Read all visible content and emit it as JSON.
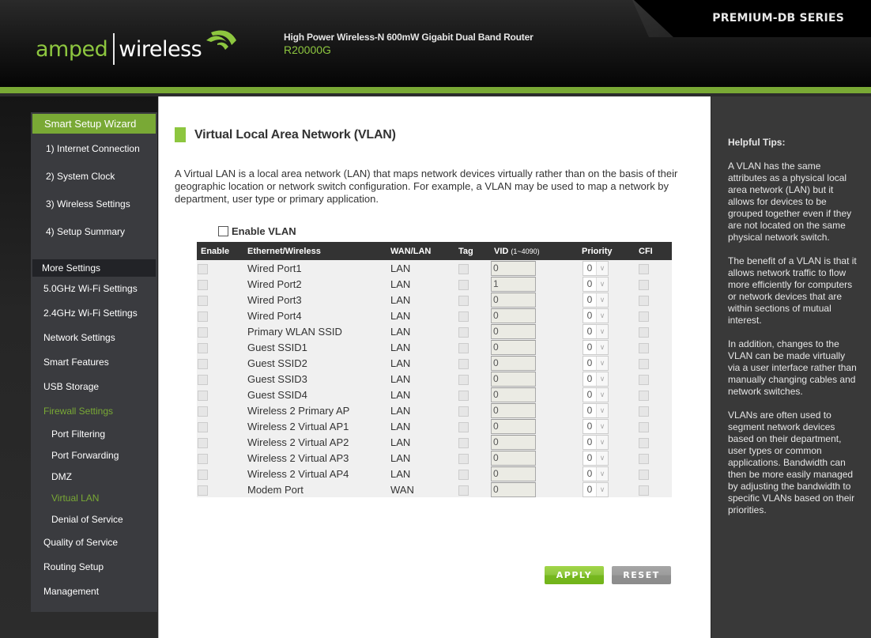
{
  "header": {
    "brand_left": "amped",
    "brand_right": "wireless",
    "product_desc": "High Power Wireless-N 600mW Gigabit Dual Band Router",
    "model": "R20000G",
    "series": "PREMIUM-DB SERIES"
  },
  "sidebar": {
    "wizard_title": "Smart Setup Wizard",
    "wizard_items": [
      {
        "label": "1) Internet Connection"
      },
      {
        "label": "2) System Clock"
      },
      {
        "label": "3) Wireless Settings"
      },
      {
        "label": "4) Setup Summary"
      }
    ],
    "more_title": "More Settings",
    "nav_items_top": [
      {
        "label": "5.0GHz Wi-Fi Settings"
      },
      {
        "label": "2.4GHz Wi-Fi Settings"
      },
      {
        "label": "Network Settings"
      },
      {
        "label": "Smart Features"
      },
      {
        "label": "USB Storage"
      },
      {
        "label": "Firewall Settings",
        "active": true
      }
    ],
    "firewall_sub": [
      {
        "label": "Port Filtering"
      },
      {
        "label": "Port Forwarding"
      },
      {
        "label": "DMZ"
      },
      {
        "label": "Virtual LAN",
        "active": true
      },
      {
        "label": "Denial of Service"
      }
    ],
    "nav_items_bottom": [
      {
        "label": "Quality of Service"
      },
      {
        "label": "Routing Setup"
      },
      {
        "label": "Management"
      }
    ]
  },
  "main": {
    "title": "Virtual Local Area Network (VLAN)",
    "intro": "A Virtual LAN is a local area network (LAN) that maps network devices virtually rather than on the basis of their geographic location or network switch configuration. For example, a VLAN may be used to map a network by department, user type or primary application.",
    "enable_vlan_label": "Enable VLAN",
    "enable_vlan_checked": false,
    "table": {
      "headers": {
        "enable": "Enable",
        "iface": "Ethernet/Wireless",
        "wanlan": "WAN/LAN",
        "tag": "Tag",
        "vid": "VID",
        "vid_range": "(1~4090)",
        "priority": "Priority",
        "cfi": "CFI"
      },
      "rows": [
        {
          "iface": "Wired Port1",
          "wanlan": "LAN",
          "vid": "0",
          "priority": "0"
        },
        {
          "iface": "Wired Port2",
          "wanlan": "LAN",
          "vid": "1",
          "priority": "0"
        },
        {
          "iface": "Wired Port3",
          "wanlan": "LAN",
          "vid": "0",
          "priority": "0"
        },
        {
          "iface": "Wired Port4",
          "wanlan": "LAN",
          "vid": "0",
          "priority": "0"
        },
        {
          "iface": "Primary WLAN SSID",
          "wanlan": "LAN",
          "vid": "0",
          "priority": "0"
        },
        {
          "iface": "Guest SSID1",
          "wanlan": "LAN",
          "vid": "0",
          "priority": "0"
        },
        {
          "iface": "Guest SSID2",
          "wanlan": "LAN",
          "vid": "0",
          "priority": "0"
        },
        {
          "iface": "Guest SSID3",
          "wanlan": "LAN",
          "vid": "0",
          "priority": "0"
        },
        {
          "iface": "Guest SSID4",
          "wanlan": "LAN",
          "vid": "0",
          "priority": "0"
        },
        {
          "iface": "Wireless 2 Primary AP",
          "wanlan": "LAN",
          "vid": "0",
          "priority": "0"
        },
        {
          "iface": "Wireless 2 Virtual AP1",
          "wanlan": "LAN",
          "vid": "0",
          "priority": "0"
        },
        {
          "iface": "Wireless 2 Virtual AP2",
          "wanlan": "LAN",
          "vid": "0",
          "priority": "0"
        },
        {
          "iface": "Wireless 2 Virtual AP3",
          "wanlan": "LAN",
          "vid": "0",
          "priority": "0"
        },
        {
          "iface": "Wireless 2 Virtual AP4",
          "wanlan": "LAN",
          "vid": "0",
          "priority": "0"
        },
        {
          "iface": "Modem Port",
          "wanlan": "WAN",
          "vid": "0",
          "priority": "0"
        }
      ]
    },
    "apply_label": "APPLY",
    "reset_label": "RESET"
  },
  "tips": {
    "title": "Helpful Tips:",
    "paragraphs": [
      "A VLAN has the same attributes as a physical local area network (LAN) but it allows for devices to be grouped together even if they are not located on the same physical network switch.",
      "The benefit of a VLAN is that it allows network traffic to flow more efficiently for computers or network devices that are within sections of mutual interest.",
      "In addition, changes to the VLAN can be made virtually via a user interface rather than manually changing cables and network switches.",
      "VLANs are often used to segment network devices based on their department, user types or common applications. Bandwidth can then be more easily managed by adjusting the bandwidth to specific VLANs based on their priorities."
    ]
  },
  "colors": {
    "brand_green": "#79a935",
    "accent_green": "#8dc63f"
  }
}
